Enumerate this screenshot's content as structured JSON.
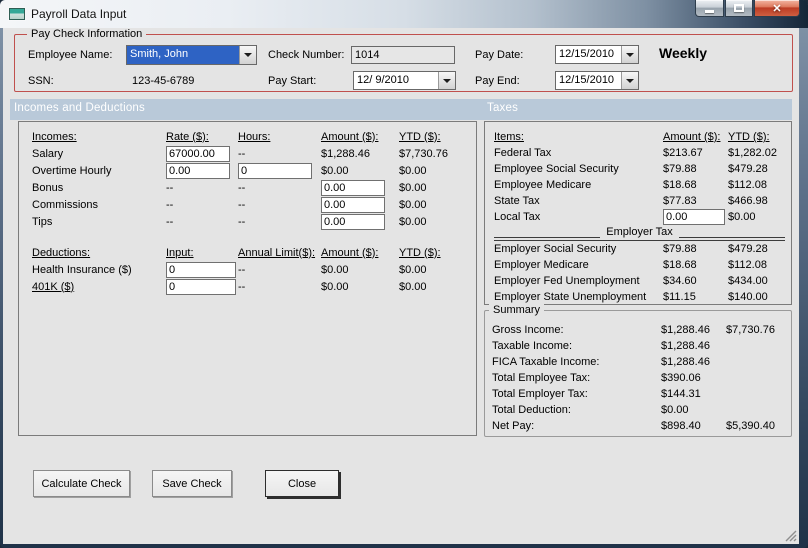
{
  "window": {
    "title": "Payroll Data Input",
    "close_glyph": "✕"
  },
  "paycheck_info": {
    "group_label": "Pay Check Information",
    "employee_name_label": "Employee Name:",
    "employee_name_value": "Smith, John",
    "ssn_label": "SSN:",
    "ssn_value": "123-45-6789",
    "check_number_label": "Check Number:",
    "check_number_value": "1014",
    "pay_start_label": "Pay Start:",
    "pay_start_value": "12/ 9/2010",
    "pay_date_label": "Pay Date:",
    "pay_date_value": "12/15/2010",
    "pay_end_label": "Pay End:",
    "pay_end_value": "12/15/2010",
    "frequency_label": "Weekly"
  },
  "section_headers": {
    "incomes_deductions": "Incomes and Deductions",
    "taxes": "Taxes"
  },
  "incomes": {
    "headers": {
      "items": "Incomes:",
      "rate": "Rate ($):",
      "hours": "Hours:",
      "amount": "Amount ($):",
      "ytd": "YTD ($):"
    },
    "rows": [
      {
        "label": "Salary",
        "rate": "67000.00",
        "hours": "--",
        "amount": "$1,288.46",
        "ytd": "$7,730.76"
      },
      {
        "label": "Overtime Hourly",
        "rate": "0.00",
        "hours": "0",
        "amount": "$0.00",
        "ytd": "$0.00"
      },
      {
        "label": "Bonus",
        "rate": "--",
        "hours": "--",
        "amount": "0.00",
        "ytd": "$0.00"
      },
      {
        "label": "Commissions",
        "rate": "--",
        "hours": "--",
        "amount": "0.00",
        "ytd": "$0.00"
      },
      {
        "label": "Tips",
        "rate": "--",
        "hours": "--",
        "amount": "0.00",
        "ytd": "$0.00"
      }
    ]
  },
  "deductions": {
    "headers": {
      "items": "Deductions:",
      "input": "Input:",
      "limit": "Annual Limit($):",
      "amount": "Amount ($):",
      "ytd": "YTD ($):"
    },
    "rows": [
      {
        "label": "Health Insurance  ($)",
        "input": "0",
        "limit": "--",
        "amount": "$0.00",
        "ytd": "$0.00"
      },
      {
        "label": "401K  ($)",
        "input": "0",
        "limit": "--",
        "amount": "$0.00",
        "ytd": "$0.00"
      }
    ]
  },
  "taxes": {
    "headers": {
      "items": "Items:",
      "amount": "Amount ($):",
      "ytd": "YTD ($):"
    },
    "employee_rows": [
      {
        "label": "Federal Tax",
        "amount": "$213.67",
        "ytd": "$1,282.02"
      },
      {
        "label": "Employee Social Security",
        "amount": "$79.88",
        "ytd": "$479.28"
      },
      {
        "label": "Employee Medicare",
        "amount": "$18.68",
        "ytd": "$112.08"
      },
      {
        "label": "State Tax",
        "amount": "$77.83",
        "ytd": "$466.98"
      }
    ],
    "local_tax": {
      "label": "Local Tax",
      "input": "0.00",
      "ytd": "$0.00"
    },
    "employer_header": "Employer Tax",
    "employer_rows": [
      {
        "label": "Employer Social Security",
        "amount": "$79.88",
        "ytd": "$479.28"
      },
      {
        "label": "Employer Medicare",
        "amount": "$18.68",
        "ytd": "$112.08"
      },
      {
        "label": "Employer Fed Unemployment",
        "amount": "$34.60",
        "ytd": "$434.00"
      },
      {
        "label": "Employer State Unemployment",
        "amount": "$11.15",
        "ytd": "$140.00"
      }
    ]
  },
  "summary": {
    "group_label": "Summary",
    "rows": [
      {
        "label": "Gross Income:",
        "amount": "$1,288.46",
        "ytd": "$7,730.76"
      },
      {
        "label": "Taxable Income:",
        "amount": "$1,288.46",
        "ytd": ""
      },
      {
        "label": "FICA Taxable Income:",
        "amount": "$1,288.46",
        "ytd": ""
      },
      {
        "label": "Total Employee Tax:",
        "amount": "$390.06",
        "ytd": ""
      },
      {
        "label": "Total Employer Tax:",
        "amount": "$144.31",
        "ytd": ""
      },
      {
        "label": "Total Deduction:",
        "amount": "$0.00",
        "ytd": ""
      },
      {
        "label": "Net Pay:",
        "amount": "$898.40",
        "ytd": "$5,390.40"
      }
    ]
  },
  "buttons": {
    "calculate": "Calculate Check",
    "save": "Save Check",
    "close": "Close"
  },
  "colors": {
    "group_border_red": "#c0504d",
    "section_bar": "#b9c9d9",
    "selection_blue": "#2e63c4",
    "close_button_red": "#d04437"
  }
}
